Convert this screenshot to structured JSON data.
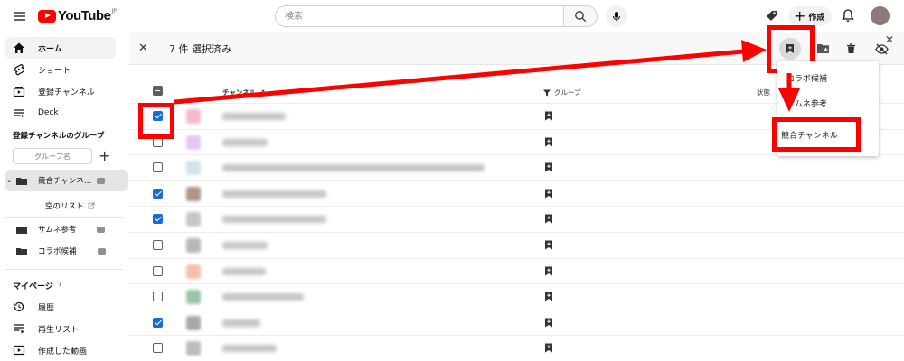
{
  "header": {
    "logo_text": "YouTube",
    "logo_region": "JP",
    "search_placeholder": "検索",
    "create_label": "作成"
  },
  "sidebar": {
    "items": [
      {
        "label": "ホーム",
        "icon": "home-icon",
        "active": true
      },
      {
        "label": "ショート",
        "icon": "shorts-icon"
      },
      {
        "label": "登録チャンネル",
        "icon": "subscriptions-icon"
      },
      {
        "label": "Deck",
        "icon": "deck-icon"
      }
    ],
    "groups_heading": "登録チャンネルのグループ",
    "group_input_placeholder": "グループ名",
    "groups": [
      {
        "label": "競合チャンネ…",
        "active": true
      },
      {
        "label": "サムネ参考"
      },
      {
        "label": "コラボ候補"
      }
    ],
    "empty_list_label": "空のリスト",
    "mypage_label": "マイページ",
    "mypage_items": [
      {
        "label": "履歴",
        "icon": "history-icon"
      },
      {
        "label": "再生リスト",
        "icon": "playlist-icon"
      },
      {
        "label": "作成した動画",
        "icon": "your-videos-icon"
      }
    ]
  },
  "panel": {
    "selection_text": "7 件 選択済み",
    "columns": {
      "channel": "チャンネル",
      "group": "グループ",
      "status": "状態"
    },
    "rows": [
      {
        "checked": true,
        "thumb_color": "#f4b8d0"
      },
      {
        "checked": false,
        "thumb_color": "#e4c8f4"
      },
      {
        "checked": false,
        "thumb_color": "#cfe4ec"
      },
      {
        "checked": true,
        "thumb_color": "#b09488"
      },
      {
        "checked": true,
        "thumb_color": "#c6c6c6"
      },
      {
        "checked": false,
        "thumb_color": "#b8b8b8"
      },
      {
        "checked": false,
        "thumb_color": "#f4c0a8"
      },
      {
        "checked": false,
        "thumb_color": "#9cc4a8"
      },
      {
        "checked": true,
        "thumb_color": "#a8a8a8"
      },
      {
        "checked": false,
        "thumb_color": "#bcbcbc"
      }
    ]
  },
  "dropdown": {
    "items": [
      "コラボ候補",
      "サムネ参考",
      "競合チャンネル"
    ]
  },
  "colors": {
    "accent_red": "#ff0000",
    "checkbox_blue": "#1a6cd4"
  }
}
